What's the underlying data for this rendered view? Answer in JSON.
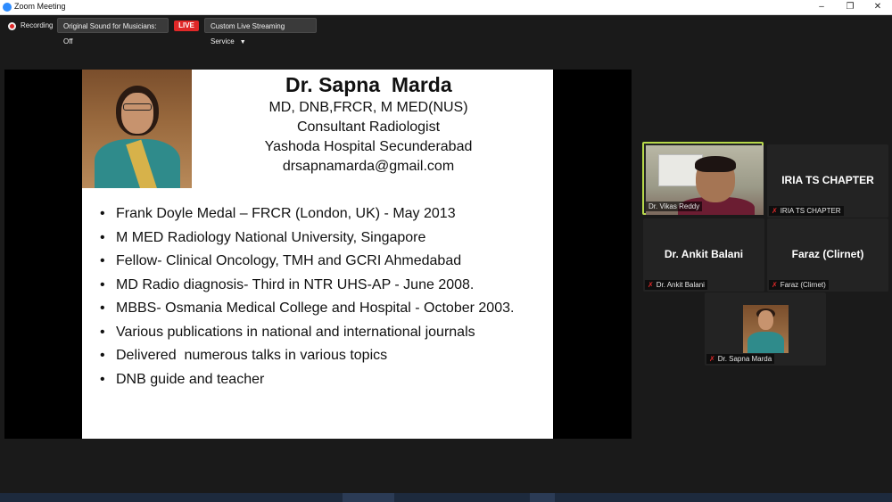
{
  "window": {
    "title": "Zoom Meeting",
    "controls": [
      "–",
      "❐",
      "✕"
    ]
  },
  "toolbar": {
    "recording_label": "Recording",
    "original_sound_label": "Original Sound for Musicians: Off",
    "live_label": "LIVE",
    "stream_service_label": "Custom Live Streaming Service"
  },
  "slide": {
    "name": "Dr. Sapna  Marda",
    "degrees": "MD, DNB,FRCR, M MED(NUS)",
    "role": "Consultant Radiologist",
    "hospital": "Yashoda Hospital Secunderabad",
    "email": "drsapnamarda@gmail.com",
    "bullet_char": "•",
    "bullets": [
      "Frank Doyle Medal – FRCR (London, UK) - May 2013",
      "M MED Radiology National University, Singapore",
      "Fellow- Clinical Oncology, TMH and GCRI Ahmedabad",
      "MD Radio diagnosis- Third in NTR UHS-AP - June 2008.",
      "MBBS- Osmania Medical College and Hospital - October 2003.",
      "Various publications in national and international journals",
      "Delivered  numerous talks in various topics",
      "DNB guide and teacher"
    ]
  },
  "participants": [
    {
      "name": "Dr. Vikas Reddy",
      "big_label": "",
      "muted": false,
      "active_speaker": true
    },
    {
      "name": "IRIA TS CHAPTER",
      "big_label": "IRIA TS CHAPTER",
      "muted": true
    },
    {
      "name": "Dr. Ankit Balani",
      "big_label": "Dr. Ankit Balani",
      "muted": true
    },
    {
      "name": "Faraz (Clirnet)",
      "big_label": "Faraz (Clirnet)",
      "muted": true
    },
    {
      "name": "Dr. Sapna Marda",
      "big_label": "",
      "muted": true
    }
  ],
  "colors": {
    "active_speaker_border": "#b7d84a",
    "live_badge": "#e02828",
    "muted_icon": "#e02828"
  }
}
